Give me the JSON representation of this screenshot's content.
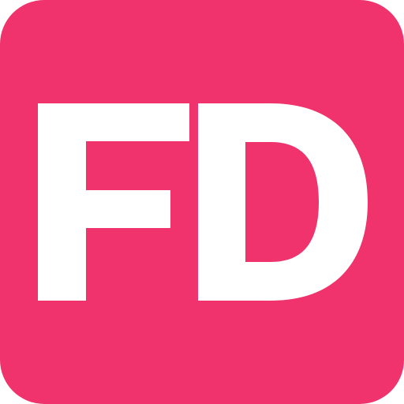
{
  "app_icon": {
    "monogram": "FD",
    "colors": {
      "background": "#f0336c",
      "foreground": "#ffffff"
    }
  }
}
